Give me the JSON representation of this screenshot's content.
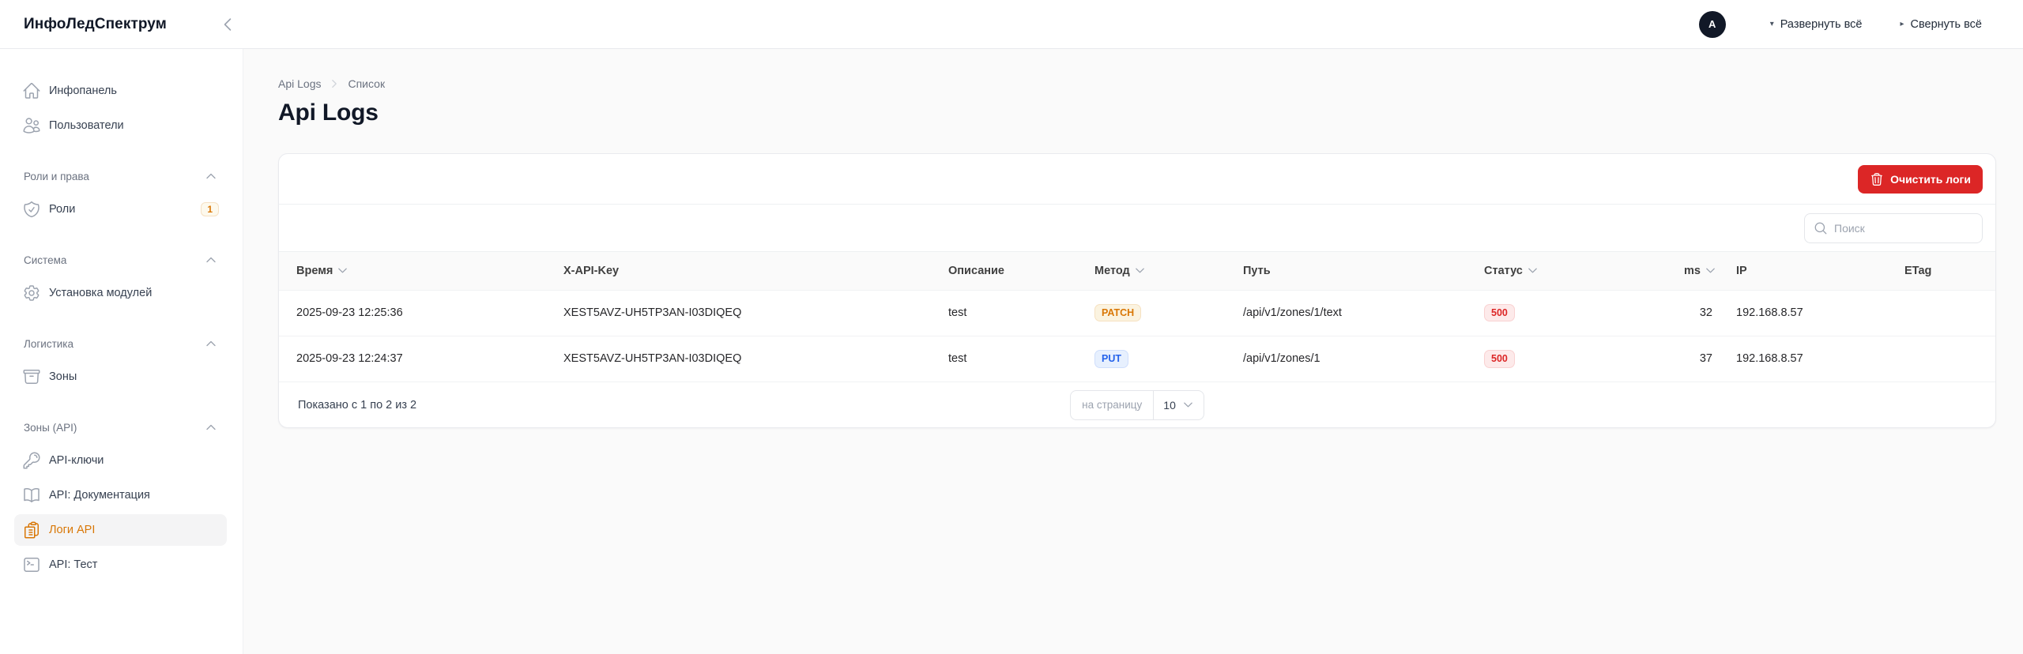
{
  "brand": "ИнфоЛедСпектрум",
  "topbar": {
    "avatar_initial": "A",
    "expand_all": "Развернуть всё",
    "collapse_all": "Свернуть всё",
    "expand_glyph": "▾",
    "collapse_glyph": "▸"
  },
  "sidebar": {
    "items": [
      {
        "label": "Инфопанель"
      },
      {
        "label": "Пользователи"
      }
    ],
    "groups": [
      {
        "label": "Роли и права",
        "items": [
          {
            "label": "Роли",
            "badge": "1"
          }
        ]
      },
      {
        "label": "Система",
        "items": [
          {
            "label": "Установка модулей"
          }
        ]
      },
      {
        "label": "Логистика",
        "items": [
          {
            "label": "Зоны"
          }
        ]
      },
      {
        "label": "Зоны (API)",
        "items": [
          {
            "label": "API-ключи"
          },
          {
            "label": "API: Документация"
          },
          {
            "label": "Логи API",
            "active": true
          },
          {
            "label": "API: Тест"
          }
        ]
      }
    ]
  },
  "breadcrumb": {
    "parent": "Api Logs",
    "current": "Список"
  },
  "page": {
    "title": "Api Logs"
  },
  "toolbar": {
    "clear_logs_label": "Очистить логи"
  },
  "search": {
    "placeholder": "Поиск"
  },
  "table": {
    "columns": [
      {
        "label": "Время",
        "sortable": true
      },
      {
        "label": "X-API-Key",
        "sortable": false
      },
      {
        "label": "Описание",
        "sortable": false
      },
      {
        "label": "Метод",
        "sortable": true
      },
      {
        "label": "Путь",
        "sortable": false
      },
      {
        "label": "Статус",
        "sortable": true
      },
      {
        "label": "ms",
        "sortable": true
      },
      {
        "label": "IP",
        "sortable": false
      },
      {
        "label": "ETag",
        "sortable": false
      }
    ],
    "rows": [
      {
        "time": "2025-09-23 12:25:36",
        "api_key": "XEST5AVZ-UH5TP3AN-I03DIQEQ",
        "description": "test",
        "method": "PATCH",
        "method_color": "warning",
        "path": "/api/v1/zones/1/text",
        "status": "500",
        "status_color": "danger",
        "ms": "32",
        "ip": "192.168.8.57",
        "etag": ""
      },
      {
        "time": "2025-09-23 12:24:37",
        "api_key": "XEST5AVZ-UH5TP3AN-I03DIQEQ",
        "description": "test",
        "method": "PUT",
        "method_color": "info",
        "path": "/api/v1/zones/1",
        "status": "500",
        "status_color": "danger",
        "ms": "37",
        "ip": "192.168.8.57",
        "etag": ""
      }
    ]
  },
  "pagination": {
    "summary": "Показано с 1 по 2 из 2",
    "per_page_label": "на страницу",
    "per_page_value": "10"
  },
  "colors": {
    "accent": "#d97706",
    "danger": "#dc2626",
    "badge_warning_text": "#d97706",
    "badge_info_text": "#2563eb",
    "badge_danger_text": "#dc2626"
  }
}
